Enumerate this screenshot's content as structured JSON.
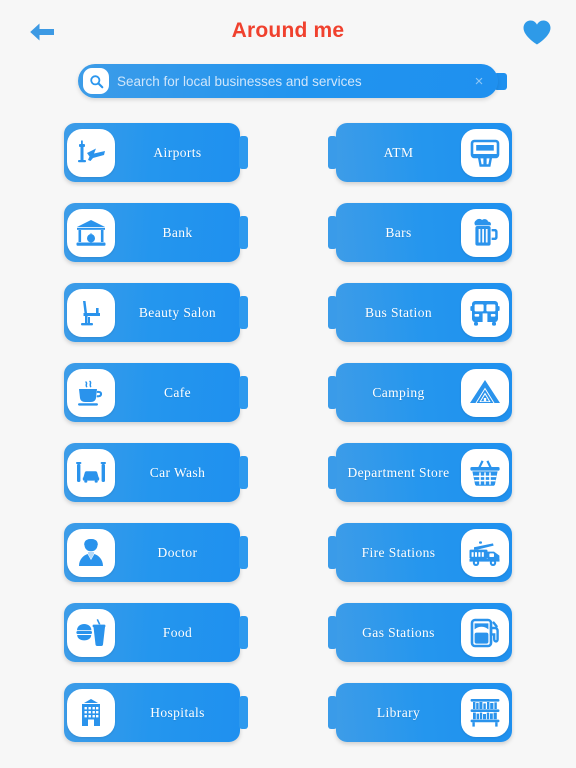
{
  "header": {
    "title": "Around me",
    "title_color": "#f0412e",
    "back_icon": "back-arrow-icon",
    "favorite_icon": "heart-icon",
    "accent_color": "#2094ef"
  },
  "search": {
    "placeholder": "Search for local businesses and services",
    "value": "",
    "icon": "search-icon",
    "clear_icon": "close-icon",
    "clear_label": "×"
  },
  "grid": {
    "left_column": [
      {
        "label": "Airports",
        "icon": "airport-icon"
      },
      {
        "label": "Bank",
        "icon": "bank-icon"
      },
      {
        "label": "Beauty Salon",
        "icon": "salon-chair-icon"
      },
      {
        "label": "Cafe",
        "icon": "coffee-cup-icon"
      },
      {
        "label": "Car Wash",
        "icon": "car-wash-icon"
      },
      {
        "label": "Doctor",
        "icon": "doctor-icon"
      },
      {
        "label": "Food",
        "icon": "fast-food-icon"
      },
      {
        "label": "Hospitals",
        "icon": "hospital-building-icon"
      }
    ],
    "right_column": [
      {
        "label": "ATM",
        "icon": "atm-machine-icon"
      },
      {
        "label": "Bars",
        "icon": "beer-mug-icon"
      },
      {
        "label": "Bus Station",
        "icon": "bus-icon"
      },
      {
        "label": "Camping",
        "icon": "tent-icon"
      },
      {
        "label": "Department Store",
        "icon": "shopping-basket-icon"
      },
      {
        "label": "Fire Stations",
        "icon": "fire-truck-icon"
      },
      {
        "label": "Gas Stations",
        "icon": "fuel-pump-icon"
      },
      {
        "label": "Library",
        "icon": "bookshelf-icon"
      }
    ]
  }
}
